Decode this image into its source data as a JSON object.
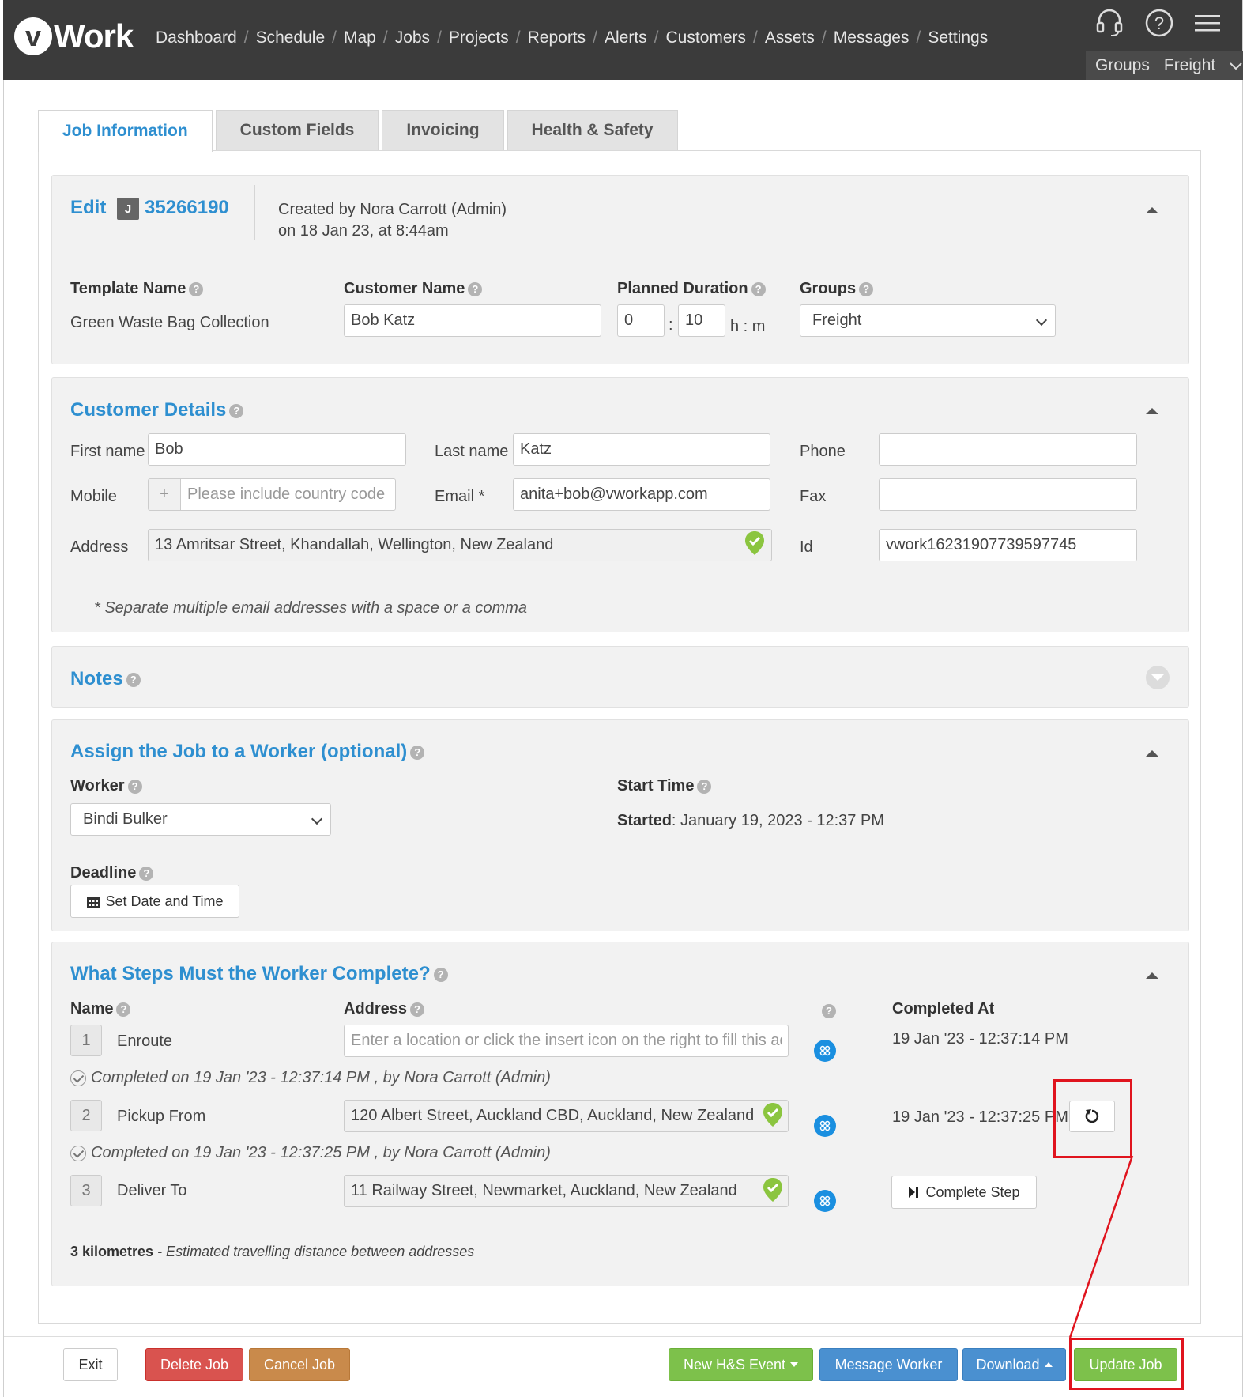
{
  "app": {
    "logo_letter": "v",
    "logo_text": "Work"
  },
  "nav": {
    "items": [
      "Dashboard",
      "Schedule",
      "Map",
      "Jobs",
      "Projects",
      "Reports",
      "Alerts",
      "Customers",
      "Assets",
      "Messages",
      "Settings"
    ],
    "separator": "/"
  },
  "groups_bar": {
    "label": "Groups",
    "value": "Freight"
  },
  "tabs": [
    "Job Information",
    "Custom Fields",
    "Invoicing",
    "Health & Safety"
  ],
  "edit": {
    "title": "Edit",
    "badge": "J",
    "job_number": "35266190",
    "created_line1": "Created by Nora Carrott (Admin)",
    "created_line2": "on 18 Jan 23, at 8:44am"
  },
  "job_fields": {
    "template_label": "Template Name",
    "template_value": "Green Waste Bag Collection",
    "customer_label": "Customer Name",
    "customer_value": "Bob Katz",
    "duration_label": "Planned Duration",
    "duration_hours": "0",
    "duration_sep": ":",
    "duration_minutes": "10",
    "duration_unit": "h : m",
    "groups_label": "Groups",
    "groups_value": "Freight"
  },
  "customer_details": {
    "title": "Customer Details",
    "first_name_label": "First name",
    "first_name": "Bob",
    "last_name_label": "Last name",
    "last_name": "Katz",
    "phone_label": "Phone",
    "phone": "",
    "mobile_label": "Mobile",
    "mobile_prefix": "+",
    "mobile_placeholder": "Please include country code",
    "email_label": "Email *",
    "email": "anita+bob@vworkapp.com",
    "fax_label": "Fax",
    "fax": "",
    "address_label": "Address",
    "address": "13 Amritsar Street, Khandallah, Wellington, New Zealand",
    "id_label": "Id",
    "id_value": "vwork16231907739597745",
    "email_note": "* Separate multiple email addresses with a space or a comma"
  },
  "notes": {
    "title": "Notes"
  },
  "assign": {
    "title": "Assign the Job to a Worker (optional)",
    "worker_label": "Worker",
    "worker_value": "Bindi Bulker",
    "start_time_label": "Start Time",
    "started_label": "Started",
    "started_value": ": January 19, 2023 - 12:37 PM",
    "deadline_label": "Deadline",
    "set_date_button": "Set Date and Time"
  },
  "steps": {
    "title": "What Steps Must the Worker Complete?",
    "name_header": "Name",
    "address_header": "Address",
    "completed_header": "Completed At",
    "address_placeholder": "Enter a location or click the insert icon on the right to fill this address",
    "rows": [
      {
        "num": "1",
        "name": "Enroute",
        "address": "",
        "completed_at": "19 Jan '23 - 12:37:14 PM"
      },
      {
        "num": "2",
        "name": "Pickup From",
        "address": "120 Albert Street, Auckland CBD, Auckland, New Zealand",
        "completed_at": "19 Jan '23 - 12:37:25 PM"
      },
      {
        "num": "3",
        "name": "Deliver To",
        "address": "11 Railway Street, Newmarket, Auckland, New Zealand",
        "completed_at": ""
      }
    ],
    "completed_notes": [
      "Completed on 19 Jan '23 - 12:37:14 PM , by Nora Carrott (Admin)",
      "Completed on 19 Jan '23 - 12:37:25 PM , by Nora Carrott (Admin)"
    ],
    "complete_step_button": "Complete Step",
    "distance_value": "3 kilometres",
    "distance_text": " - Estimated travelling distance between addresses"
  },
  "footer": {
    "exit": "Exit",
    "delete": "Delete Job",
    "cancel": "Cancel Job",
    "new_hs": "New H&S Event",
    "message": "Message Worker",
    "download": "Download",
    "update": "Update Job"
  },
  "colors": {
    "topbar": "#3b3b3b",
    "accent_blue": "#2e8fd0",
    "green": "#7dc14b",
    "red": "#d9534f",
    "orange": "#c98a4b",
    "blue_button": "#4a90d0",
    "highlight": "#e0141e"
  },
  "icons": [
    "headset-icon",
    "help-circle-icon",
    "hamburger-menu-icon",
    "chevron-down-icon",
    "map-pin-check-icon",
    "insert-location-icon",
    "calendar-icon",
    "undo-icon",
    "step-forward-icon"
  ]
}
